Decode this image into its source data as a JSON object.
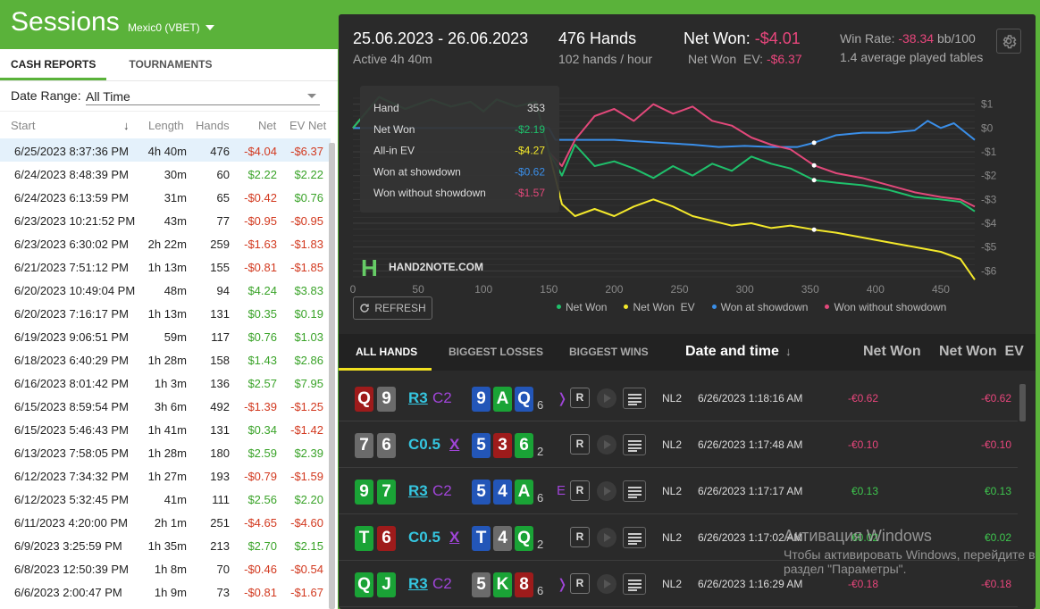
{
  "app": {
    "title": "Sessions",
    "account": "Mexic0 (VBET)"
  },
  "left_tabs": [
    "CASH REPORTS",
    "TOURNAMENTS"
  ],
  "date_range": {
    "label": "Date Range:",
    "value": "All Time"
  },
  "sessions_headers": {
    "start": "Start",
    "sort_arrow": "↓",
    "length": "Length",
    "hands": "Hands",
    "net": "Net",
    "ev_net": "EV Net"
  },
  "sessions": [
    {
      "start": "6/25/2023 8:37:36 PM",
      "length": "4h 40m",
      "hands": "476",
      "net": "-$4.04",
      "ev": "-$6.37"
    },
    {
      "start": "6/24/2023 8:48:39 PM",
      "length": "30m",
      "hands": "60",
      "net": "$2.22",
      "ev": "$2.22"
    },
    {
      "start": "6/24/2023 6:13:59 PM",
      "length": "31m",
      "hands": "65",
      "net": "-$0.42",
      "ev": "$0.76"
    },
    {
      "start": "6/23/2023 10:21:52 PM",
      "length": "43m",
      "hands": "77",
      "net": "-$0.95",
      "ev": "-$0.95"
    },
    {
      "start": "6/23/2023 6:30:02 PM",
      "length": "2h 22m",
      "hands": "259",
      "net": "-$1.63",
      "ev": "-$1.83"
    },
    {
      "start": "6/21/2023 7:51:12 PM",
      "length": "1h 13m",
      "hands": "155",
      "net": "-$0.81",
      "ev": "-$1.85"
    },
    {
      "start": "6/20/2023 10:49:04 PM",
      "length": "48m",
      "hands": "94",
      "net": "$4.24",
      "ev": "$3.83"
    },
    {
      "start": "6/20/2023 7:16:17 PM",
      "length": "1h 13m",
      "hands": "131",
      "net": "$0.35",
      "ev": "$0.19"
    },
    {
      "start": "6/19/2023 9:06:51 PM",
      "length": "59m",
      "hands": "117",
      "net": "$0.76",
      "ev": "$1.03"
    },
    {
      "start": "6/18/2023 6:40:29 PM",
      "length": "1h 28m",
      "hands": "158",
      "net": "$1.43",
      "ev": "$2.86"
    },
    {
      "start": "6/16/2023 8:01:42 PM",
      "length": "1h 3m",
      "hands": "136",
      "net": "$2.57",
      "ev": "$7.95"
    },
    {
      "start": "6/15/2023 8:59:54 PM",
      "length": "3h 6m",
      "hands": "492",
      "net": "-$1.39",
      "ev": "-$1.25"
    },
    {
      "start": "6/15/2023 5:46:43 PM",
      "length": "1h 41m",
      "hands": "131",
      "net": "$0.34",
      "ev": "-$1.42"
    },
    {
      "start": "6/13/2023 7:58:05 PM",
      "length": "1h 28m",
      "hands": "180",
      "net": "$2.59",
      "ev": "$2.39"
    },
    {
      "start": "6/12/2023 7:34:32 PM",
      "length": "1h 27m",
      "hands": "193",
      "net": "-$0.79",
      "ev": "-$1.59"
    },
    {
      "start": "6/12/2023 5:32:45 PM",
      "length": "41m",
      "hands": "111",
      "net": "$2.56",
      "ev": "$2.20"
    },
    {
      "start": "6/11/2023 4:20:00 PM",
      "length": "2h 1m",
      "hands": "251",
      "net": "-$4.65",
      "ev": "-$4.60"
    },
    {
      "start": "6/9/2023 3:25:59 PM",
      "length": "1h 35m",
      "hands": "213",
      "net": "$2.70",
      "ev": "$2.15"
    },
    {
      "start": "6/8/2023 12:50:39 PM",
      "length": "1h 8m",
      "hands": "70",
      "net": "-$0.46",
      "ev": "-$0.54"
    },
    {
      "start": "6/6/2023 2:00:47 PM",
      "length": "1h 9m",
      "hands": "73",
      "net": "-$0.81",
      "ev": "-$1.67"
    }
  ],
  "summary": {
    "dates": "25.06.2023 - 26.06.2023",
    "active": "Active 4h 40m",
    "hands": "476 Hands",
    "hands_per_hour": "102 hands / hour",
    "net_won_label": "Net Won:",
    "net_won_value": "-$4.01",
    "net_won_ev_label": "Net Won  EV:",
    "net_won_ev_value": "-$6.37",
    "win_rate_label": "Win Rate:",
    "win_rate_value": "-38.34",
    "win_rate_unit": "bb/100",
    "avg_tables": "1.4 average played tables"
  },
  "tooltip": {
    "rows": [
      {
        "label": "Hand",
        "value": "353"
      },
      {
        "label": "Net Won",
        "value": "-$2.19"
      },
      {
        "label": "All-in EV",
        "value": "-$4.27"
      },
      {
        "label": "Won at showdown",
        "value": "-$0.62"
      },
      {
        "label": "Won without showdown",
        "value": "-$1.57"
      }
    ]
  },
  "brand": {
    "logo_letter": "H",
    "name": "HAND2NOTE.COM"
  },
  "chart_data": {
    "type": "line",
    "xlim": [
      0,
      476
    ],
    "ylim": [
      -6.4,
      1.4
    ],
    "x_ticks": [
      0,
      50,
      100,
      150,
      200,
      250,
      300,
      350,
      400,
      450
    ],
    "y_ticks": [
      1,
      0,
      -1,
      -2,
      -3,
      -4,
      -5,
      -6
    ],
    "y_tick_labels": [
      "$1",
      "$0",
      "-$1",
      "-$2",
      "-$3",
      "-$4",
      "-$5",
      "-$6"
    ],
    "series": [
      {
        "name": "Net Won",
        "color": "#1fc06b",
        "x": [
          0,
          20,
          40,
          60,
          75,
          90,
          100,
          110,
          125,
          140,
          150,
          160,
          170,
          185,
          200,
          215,
          230,
          245,
          260,
          275,
          290,
          305,
          320,
          335,
          353,
          370,
          390,
          410,
          430,
          450,
          465,
          476
        ],
        "y": [
          0,
          1.3,
          0.8,
          1.2,
          0.9,
          1.1,
          0.7,
          1.2,
          0.9,
          1.1,
          -1.0,
          -2.0,
          -0.7,
          -1.6,
          -1.4,
          -1.7,
          -2.1,
          -1.6,
          -2.0,
          -1.5,
          -1.8,
          -1.2,
          -1.5,
          -1.7,
          -2.19,
          -2.3,
          -2.4,
          -2.6,
          -2.9,
          -3.0,
          -3.1,
          -3.5
        ]
      },
      {
        "name": "Net Won  EV",
        "color": "#f3e82b",
        "x": [
          0,
          20,
          40,
          60,
          75,
          90,
          100,
          110,
          125,
          140,
          150,
          160,
          170,
          185,
          200,
          215,
          230,
          245,
          260,
          275,
          290,
          305,
          320,
          335,
          353,
          370,
          390,
          410,
          430,
          450,
          465,
          476
        ],
        "y": [
          0,
          1.3,
          0.8,
          1.2,
          0.9,
          1.1,
          0.7,
          1.2,
          0.9,
          1.1,
          -1.0,
          -3.2,
          -3.7,
          -3.4,
          -3.7,
          -3.3,
          -3.0,
          -3.3,
          -3.7,
          -3.9,
          -4.1,
          -4.0,
          -4.2,
          -4.1,
          -4.27,
          -4.4,
          -4.6,
          -4.8,
          -5.0,
          -5.2,
          -5.5,
          -6.37
        ]
      },
      {
        "name": "Won at showdown",
        "color": "#3a8ee8",
        "x": [
          0,
          50,
          100,
          150,
          155,
          200,
          230,
          260,
          280,
          300,
          320,
          340,
          353,
          370,
          390,
          410,
          430,
          440,
          450,
          460,
          476
        ],
        "y": [
          0,
          0,
          0,
          0,
          -0.5,
          -0.5,
          -0.6,
          -0.7,
          -0.8,
          -0.75,
          -0.8,
          -0.8,
          -0.62,
          -0.3,
          -0.2,
          -0.2,
          -0.1,
          0.3,
          0,
          0.2,
          -0.5
        ]
      },
      {
        "name": "Won without showdown",
        "color": "#e2487a",
        "x": [
          0,
          20,
          40,
          60,
          75,
          90,
          100,
          110,
          125,
          140,
          150,
          160,
          170,
          185,
          200,
          215,
          230,
          245,
          260,
          275,
          290,
          305,
          320,
          335,
          353,
          370,
          390,
          410,
          430,
          450,
          465,
          476
        ],
        "y": [
          0,
          1.3,
          0.8,
          1.2,
          0.9,
          1.1,
          0.7,
          1.2,
          0.9,
          1.1,
          -1.0,
          -1.6,
          -0.5,
          0.5,
          0.8,
          0.3,
          1.0,
          0.6,
          0.9,
          0.3,
          0.1,
          -0.4,
          -0.7,
          -0.9,
          -1.57,
          -1.9,
          -2.1,
          -2.4,
          -2.7,
          -2.9,
          -3.0,
          -3.3
        ]
      }
    ],
    "highlight_x": 353,
    "legend_position": "bottom",
    "grid": true
  },
  "refresh_label": "REFRESH",
  "hand_tabs": [
    "ALL HANDS",
    "BIGGEST LOSSES",
    "BIGGEST WINS"
  ],
  "hand_columns": {
    "date": "Date and time",
    "sort_arrow": "↓",
    "net": "Net Won",
    "net_ev": "Net Won  EV"
  },
  "hands": [
    {
      "cards": [
        [
          "Q",
          "cr"
        ],
        [
          "9",
          "cx"
        ]
      ],
      "action": [
        [
          "R3",
          "act-link"
        ],
        [
          "C2",
          "act-c"
        ]
      ],
      "board": [
        [
          "9",
          "cb"
        ],
        [
          "A",
          "cg"
        ],
        [
          "Q",
          "cb"
        ]
      ],
      "players": "6",
      "extra": "❭",
      "r": "R",
      "limit": "NL2",
      "date": "6/26/2023 1:18:16 AM",
      "net": "-€0.62",
      "net_ev": "-€0.62",
      "sign": "vpink"
    },
    {
      "cards": [
        [
          "7",
          "cx"
        ],
        [
          "6",
          "cx"
        ]
      ],
      "action": [
        [
          "C0.5",
          "act-plain"
        ],
        [
          "X",
          "act-x"
        ]
      ],
      "board": [
        [
          "5",
          "cb"
        ],
        [
          "3",
          "cr"
        ],
        [
          "6",
          "cg"
        ]
      ],
      "players": "2",
      "extra": "",
      "r": "R",
      "limit": "NL2",
      "date": "6/26/2023 1:17:48 AM",
      "net": "-€0.10",
      "net_ev": "-€0.10",
      "sign": "vpink"
    },
    {
      "cards": [
        [
          "9",
          "cg"
        ],
        [
          "7",
          "cg"
        ]
      ],
      "action": [
        [
          "R3",
          "act-link"
        ],
        [
          "C2",
          "act-c"
        ]
      ],
      "board": [
        [
          "5",
          "cb"
        ],
        [
          "4",
          "cb"
        ],
        [
          "A",
          "cg"
        ]
      ],
      "players": "6",
      "extra": "E",
      "r": "R",
      "limit": "NL2",
      "date": "6/26/2023 1:17:17 AM",
      "net": "€0.13",
      "net_ev": "€0.13",
      "sign": "vgreen"
    },
    {
      "cards": [
        [
          "T",
          "cg"
        ],
        [
          "6",
          "cr"
        ]
      ],
      "action": [
        [
          "C0.5",
          "act-plain"
        ],
        [
          "X",
          "act-x"
        ]
      ],
      "board": [
        [
          "T",
          "cb"
        ],
        [
          "4",
          "cx"
        ],
        [
          "Q",
          "cg"
        ]
      ],
      "players": "2",
      "extra": "",
      "r": "R",
      "limit": "NL2",
      "date": "6/26/2023 1:17:02 AM",
      "net": "€0.02",
      "net_ev": "€0.02",
      "sign": "vgreen"
    },
    {
      "cards": [
        [
          "Q",
          "cg"
        ],
        [
          "J",
          "cg"
        ]
      ],
      "action": [
        [
          "R3",
          "act-link"
        ],
        [
          "C2",
          "act-c"
        ]
      ],
      "board": [
        [
          "5",
          "cx"
        ],
        [
          "K",
          "cg"
        ],
        [
          "8",
          "cr"
        ]
      ],
      "players": "6",
      "extra": "❭",
      "r": "R",
      "limit": "NL2",
      "date": "6/26/2023 1:16:29 AM",
      "net": "-€0.18",
      "net_ev": "-€0.18",
      "sign": "vpink"
    }
  ],
  "watermark": {
    "line1": "Активация Windows",
    "line2": "Чтобы активировать Windows, перейдите в",
    "line3": "раздел \"Параметры\"."
  }
}
